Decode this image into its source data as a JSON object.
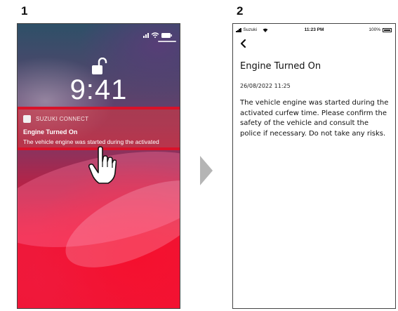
{
  "steps": {
    "step1": "1",
    "step2": "2"
  },
  "lock_screen": {
    "time": "9:41",
    "notification": {
      "app_name": "SUZUKI CONNECT",
      "title": "Engine Turned On",
      "body": "The vehicle engine was started during the activated"
    }
  },
  "detail_screen": {
    "status_bar": {
      "carrier": "Suzuki",
      "time": "11:23 PM",
      "battery": "100%"
    },
    "title": "Engine Turned On",
    "date": "26/08/2022 11:25",
    "message": "The vehicle engine was started during the activated curfew time. Please confirm the safety of the vehicle and consult the police if necessary. Do not take any risks."
  },
  "colors": {
    "highlight": "#d8122a",
    "text": "#111111"
  },
  "icons": [
    "lock-open-icon",
    "signal-icon",
    "wifi-icon",
    "battery-icon",
    "hand-pointer-icon",
    "arrow-right-icon",
    "back-chevron-icon",
    "app-icon"
  ]
}
